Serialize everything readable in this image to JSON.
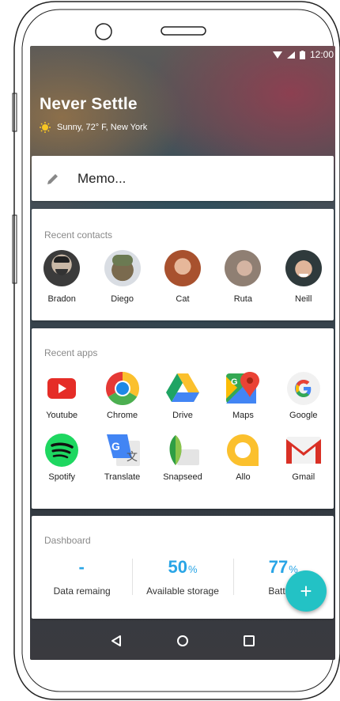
{
  "status": {
    "time": "12:00"
  },
  "hero": {
    "title": "Never Settle",
    "weather": "Sunny, 72° F, New York"
  },
  "memo": {
    "placeholder": "Memo..."
  },
  "contacts": {
    "title": "Recent contacts",
    "items": [
      {
        "name": "Bradon"
      },
      {
        "name": "Diego"
      },
      {
        "name": "Cat"
      },
      {
        "name": "Ruta"
      },
      {
        "name": "Neill"
      }
    ]
  },
  "apps": {
    "title": "Recent apps",
    "items": [
      {
        "label": "Youtube",
        "icon": "youtube-icon"
      },
      {
        "label": "Chrome",
        "icon": "chrome-icon"
      },
      {
        "label": "Drive",
        "icon": "drive-icon"
      },
      {
        "label": "Maps",
        "icon": "maps-icon"
      },
      {
        "label": "Google",
        "icon": "google-icon"
      },
      {
        "label": "Spotify",
        "icon": "spotify-icon"
      },
      {
        "label": "Translate",
        "icon": "translate-icon"
      },
      {
        "label": "Snapseed",
        "icon": "snapseed-icon"
      },
      {
        "label": "Allo",
        "icon": "allo-icon"
      },
      {
        "label": "Gmail",
        "icon": "gmail-icon"
      }
    ]
  },
  "dashboard": {
    "title": "Dashboard",
    "stats": [
      {
        "value": "-",
        "unit": "",
        "label": "Data remaing"
      },
      {
        "value": "50",
        "unit": "%",
        "label": "Available storage"
      },
      {
        "value": "77",
        "unit": "%",
        "label": "Battery"
      }
    ]
  },
  "fab": {
    "label": "+"
  },
  "colors": {
    "accent": "#29a5e6",
    "fab": "#23c2c5"
  }
}
